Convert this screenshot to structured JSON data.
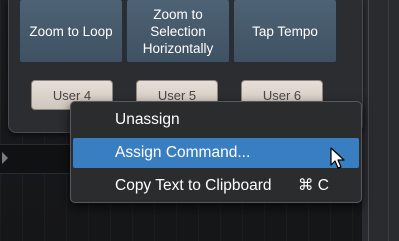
{
  "command_buttons": [
    {
      "label": "Zoom to Loop"
    },
    {
      "label": "Zoom to\nSelection\nHorizontally"
    },
    {
      "label": "Tap Tempo"
    }
  ],
  "user_buttons": [
    {
      "label": "User 4"
    },
    {
      "label": "User 5"
    },
    {
      "label": "User 6"
    }
  ],
  "context_menu": {
    "items": [
      {
        "label": "Unassign"
      },
      {
        "label": "Assign Command...",
        "selected": true
      },
      {
        "label": "Copy Text to Clipboard",
        "shortcut": "⌘ C"
      }
    ]
  },
  "colors": {
    "selection": "#3a7ec2",
    "command_button": "#4a5e70",
    "user_button": "#ddd5cc",
    "menu_bg": "#2b2c2e"
  },
  "icons": [
    "arrow-pointer-icon"
  ]
}
